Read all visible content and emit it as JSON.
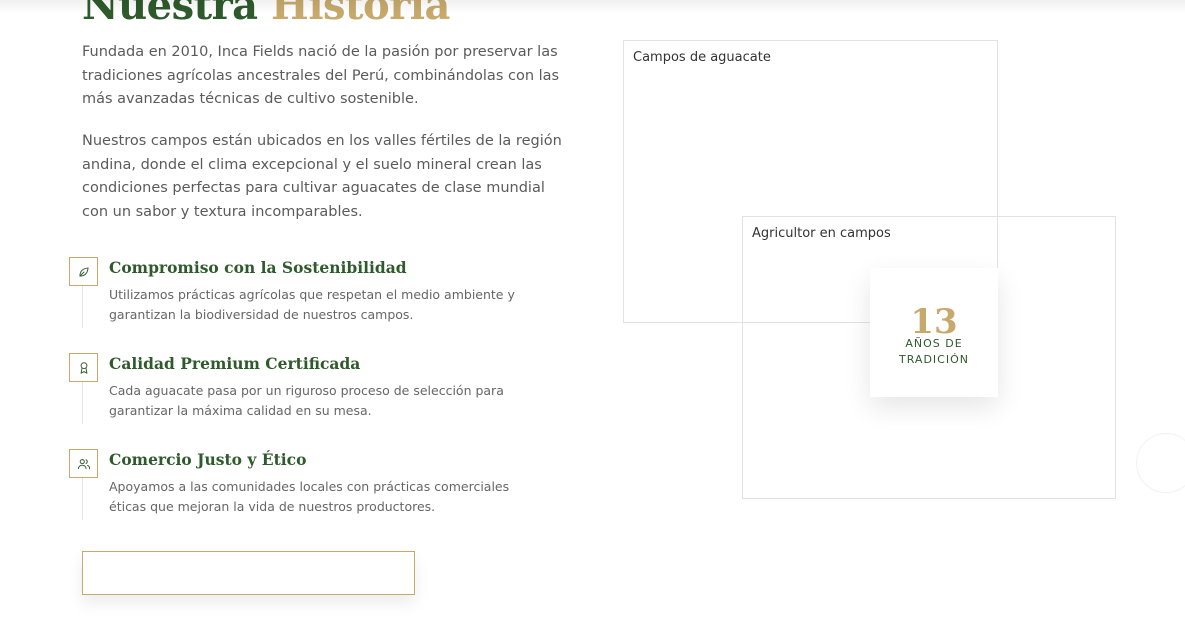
{
  "heading": {
    "word1": "Nuestra",
    "word2": "Historia"
  },
  "paragraphs": [
    "Fundada en 2010, Inca Fields nació de la pasión por preservar las tradiciones agrícolas ancestrales del Perú, combinándolas con las más avanzadas técnicas de cultivo sostenible.",
    "Nuestros campos están ubicados en los valles fértiles de la región andina, donde el clima excepcional y el suelo mineral crean las condiciones perfectas para cultivar aguacates de clase mundial con un sabor y textura incomparables."
  ],
  "features": [
    {
      "icon": "leaf-icon",
      "title": "Compromiso con la Sostenibilidad",
      "description": "Utilizamos prácticas agrícolas que respetan el medio ambiente y garantizan la biodiversidad de nuestros campos."
    },
    {
      "icon": "award-icon",
      "title": "Calidad Premium Certificada",
      "description": "Cada aguacate pasa por un riguroso proceso de selección para garantizar la máxima calidad en su mesa."
    },
    {
      "icon": "users-icon",
      "title": "Comercio Justo y Ético",
      "description": "Apoyamos a las comunidades locales con prácticas comerciales éticas que mejoran la vida de nuestros productores."
    }
  ],
  "cta": {
    "label": ""
  },
  "images": {
    "primary_alt": "Campos de aguacate",
    "secondary_alt": "Agricultor en campos"
  },
  "badge": {
    "number": "13",
    "label_line1": "AÑOS DE",
    "label_line2": "TRADICIÓN"
  },
  "colors": {
    "green": "#2e5a2c",
    "gold": "#c7a96b",
    "text": "#5b5b5b"
  }
}
